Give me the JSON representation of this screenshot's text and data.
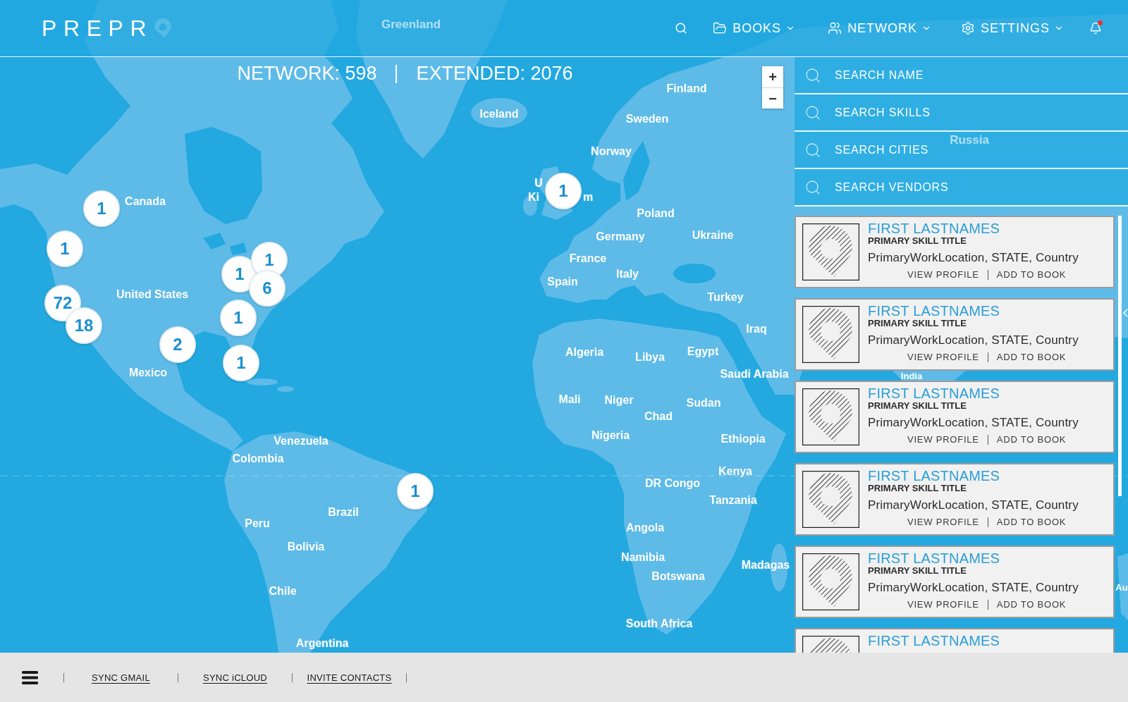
{
  "header": {
    "logo": "PREPR",
    "nav": [
      {
        "label": "BOOKS"
      },
      {
        "label": "NETWORK"
      },
      {
        "label": "SETTINGS"
      }
    ],
    "notifications": {
      "unread": true
    }
  },
  "stats": [
    "NETWORK: 598",
    "EXTENDED: 2076"
  ],
  "zoom_controls": [
    "+",
    "−"
  ],
  "map_labels": [
    "Greenland",
    "Finland",
    "Iceland",
    "Sweden",
    "Russia",
    "Norway",
    "U",
    "Canada",
    "Ki",
    "m",
    "Poland",
    "Germany",
    "Ukraine",
    "France",
    "Spain",
    "Italy",
    "United States",
    "Turkey",
    "Iraq",
    "Algeria",
    "Libya",
    "Egypt",
    "Mexico",
    "Saudi Arabia",
    "India",
    "Mali",
    "Niger",
    "Sudan",
    "Chad",
    "Venezuela",
    "Nigeria",
    "Ethiopia",
    "Colombia",
    "Kenya",
    "DR Congo",
    "Tanzania",
    "Brazil",
    "Peru",
    "Angola",
    "Bolivia",
    "Namibia",
    "Madagas",
    "Botswana",
    "Chile",
    "Au",
    "South Africa",
    "Argentina"
  ],
  "markers": [
    {
      "count": "1"
    },
    {
      "count": "1"
    },
    {
      "count": "72"
    },
    {
      "count": "18"
    },
    {
      "count": "2"
    },
    {
      "count": "1"
    },
    {
      "count": "1"
    },
    {
      "count": "6"
    },
    {
      "count": "1"
    },
    {
      "count": "1"
    },
    {
      "count": "1"
    },
    {
      "count": "1"
    }
  ],
  "search_fields": [
    {
      "placeholder": "SEARCH NAME"
    },
    {
      "placeholder": "SEARCH SKILLS"
    },
    {
      "placeholder": "SEARCH CITIES"
    },
    {
      "placeholder": "SEARCH VENDORS"
    }
  ],
  "people": [
    {
      "name": "FIRST LASTNAMES",
      "title": "PRIMARY SKILL TITLE",
      "location": "PrimaryWorkLocation, STATE, Country",
      "actions": [
        "VIEW PROFILE",
        "ADD TO BOOK"
      ]
    },
    {
      "name": "FIRST LASTNAMES",
      "title": "PRIMARY SKILL TITLE",
      "location": "PrimaryWorkLocation, STATE, Country",
      "actions": [
        "VIEW PROFILE",
        "ADD TO BOOK"
      ]
    },
    {
      "name": "FIRST LASTNAMES",
      "title": "PRIMARY SKILL TITLE",
      "location": "PrimaryWorkLocation, STATE, Country",
      "actions": [
        "VIEW PROFILE",
        "ADD TO BOOK"
      ]
    },
    {
      "name": "FIRST LASTNAMES",
      "title": "PRIMARY SKILL TITLE",
      "location": "PrimaryWorkLocation, STATE, Country",
      "actions": [
        "VIEW PROFILE",
        "ADD TO BOOK"
      ]
    },
    {
      "name": "FIRST LASTNAMES",
      "title": "PRIMARY SKILL TITLE",
      "location": "PrimaryWorkLocation, STATE, Country",
      "actions": [
        "VIEW PROFILE",
        "ADD TO BOOK"
      ]
    },
    {
      "name": "FIRST LASTNAMES"
    }
  ],
  "footer": {
    "links": [
      "SYNC GMAIL",
      "SYNC iCLOUD",
      "INVITE CONTACTS"
    ]
  }
}
